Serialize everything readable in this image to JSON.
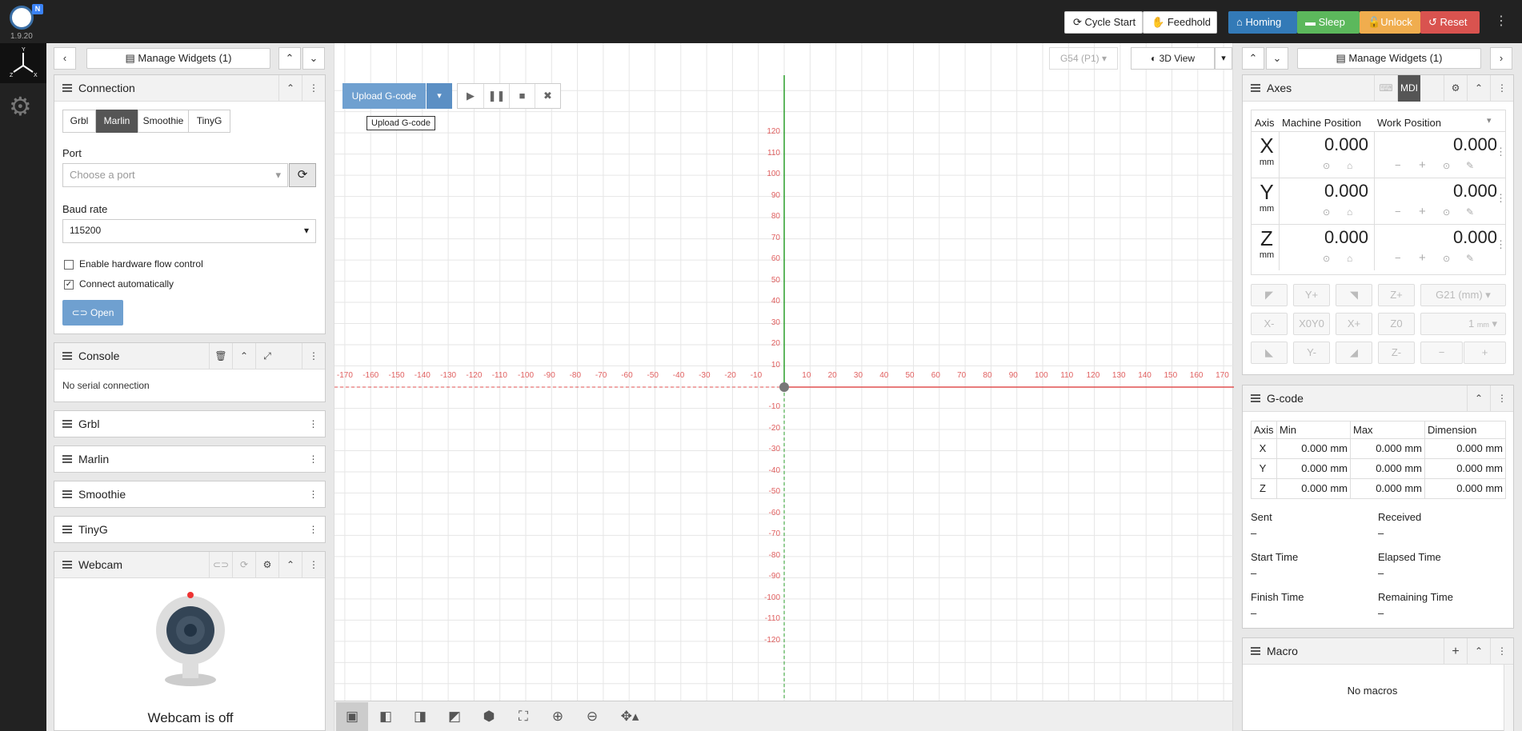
{
  "app": {
    "version": "1.9.20",
    "badge": "N"
  },
  "topbar": {
    "cycle_start": "Cycle Start",
    "feedhold": "Feedhold",
    "homing": "Homing",
    "sleep": "Sleep",
    "unlock": "Unlock",
    "reset": "Reset"
  },
  "left": {
    "manage_widgets": "Manage Widgets (1)"
  },
  "connection": {
    "title": "Connection",
    "tabs": [
      "Grbl",
      "Marlin",
      "Smoothie",
      "TinyG"
    ],
    "port_label": "Port",
    "port_placeholder": "Choose a port",
    "baud_label": "Baud rate",
    "baud_value": "115200",
    "hw_flow": "Enable hardware flow control",
    "auto_connect": "Connect automatically",
    "open": "Open"
  },
  "console": {
    "title": "Console",
    "status": "No serial connection"
  },
  "collapsed": [
    "Grbl",
    "Marlin",
    "Smoothie",
    "TinyG"
  ],
  "webcam": {
    "title": "Webcam",
    "status": "Webcam is off"
  },
  "viz": {
    "wcs": "G54 (P1)",
    "view": "3D View",
    "upload": "Upload G-code",
    "tooltip": "Upload G-code",
    "xticks": [
      "-170",
      "-160",
      "-150",
      "-140",
      "-130",
      "-120",
      "-110",
      "-100",
      "-90",
      "-80",
      "-70",
      "-60",
      "-50",
      "-40",
      "-30",
      "-20",
      "-10",
      "10",
      "20",
      "30",
      "40",
      "50",
      "60",
      "70",
      "80",
      "90",
      "100",
      "110",
      "120",
      "130",
      "140",
      "150",
      "160",
      "170"
    ],
    "yticks": [
      "120",
      "110",
      "100",
      "90",
      "80",
      "70",
      "60",
      "50",
      "40",
      "30",
      "20",
      "10",
      "-10",
      "-20",
      "-30",
      "-40",
      "-50",
      "-60",
      "-70",
      "-80",
      "-90",
      "-100",
      "-110",
      "-120"
    ]
  },
  "right": {
    "manage_widgets": "Manage Widgets (1)"
  },
  "axes": {
    "title": "Axes",
    "mdi": "MDI",
    "col_axis": "Axis",
    "col_machine": "Machine Position",
    "col_work": "Work Position",
    "rows": [
      {
        "axis": "X",
        "unit": "mm",
        "machine": "0.000",
        "work": "0.000"
      },
      {
        "axis": "Y",
        "unit": "mm",
        "machine": "0.000",
        "work": "0.000"
      },
      {
        "axis": "Z",
        "unit": "mm",
        "machine": "0.000",
        "work": "0.000"
      }
    ],
    "jog": {
      "y_plus": "Y+",
      "z_plus": "Z+",
      "units": "G21 (mm)",
      "x_minus": "X-",
      "xy_zero": "X0Y0",
      "x_plus": "X+",
      "z_zero": "Z0",
      "step": "1",
      "step_unit": "mm",
      "y_minus": "Y-",
      "z_minus": "Z-"
    }
  },
  "gcode": {
    "title": "G-code",
    "col_axis": "Axis",
    "col_min": "Min",
    "col_max": "Max",
    "col_dim": "Dimension",
    "rows": [
      {
        "axis": "X",
        "min": "0.000 mm",
        "max": "0.000 mm",
        "dim": "0.000 mm"
      },
      {
        "axis": "Y",
        "min": "0.000 mm",
        "max": "0.000 mm",
        "dim": "0.000 mm"
      },
      {
        "axis": "Z",
        "min": "0.000 mm",
        "max": "0.000 mm",
        "dim": "0.000 mm"
      }
    ],
    "sent": "Sent",
    "received": "Received",
    "start_time": "Start Time",
    "elapsed_time": "Elapsed Time",
    "finish_time": "Finish Time",
    "remaining_time": "Remaining Time",
    "empty": "–"
  },
  "macro": {
    "title": "Macro",
    "status": "No macros"
  }
}
